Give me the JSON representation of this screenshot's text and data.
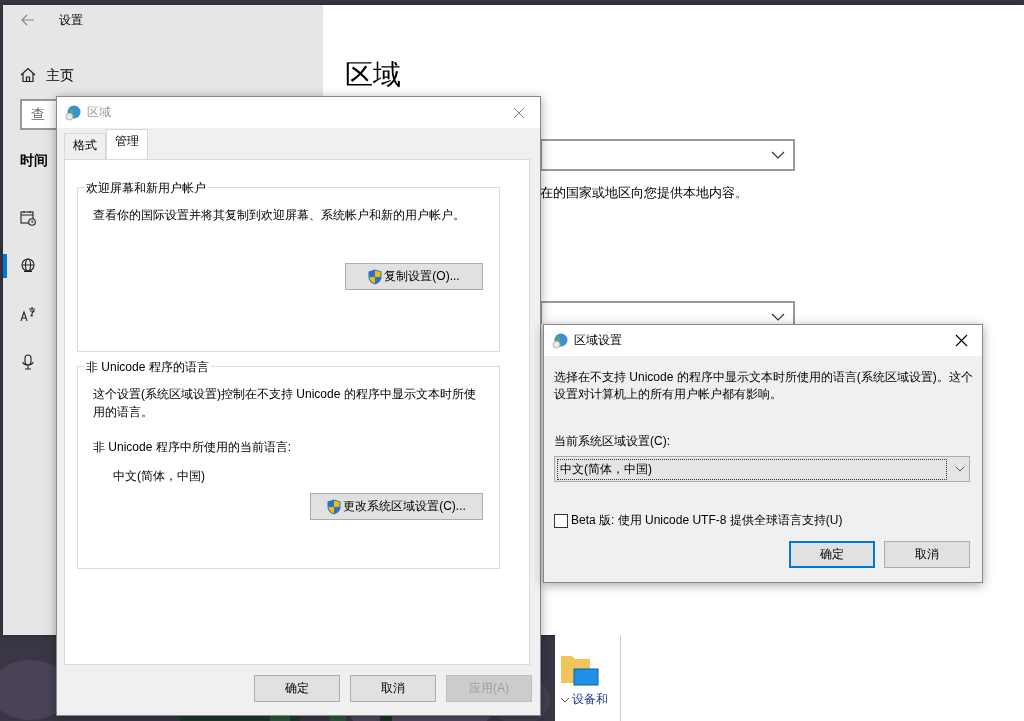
{
  "settings_window": {
    "title": "设置",
    "home": "主页",
    "search": {
      "placeholder": "查"
    },
    "section": "时间",
    "nav_items": [
      {
        "kind": "calendar",
        "selected": false
      },
      {
        "kind": "globe",
        "selected": true
      },
      {
        "kind": "language",
        "selected": false
      },
      {
        "kind": "microphone",
        "selected": false
      }
    ],
    "page_title": "区域",
    "region_text": "在的国家或地区向您提供本地内容。"
  },
  "region_dialog": {
    "title": "区域",
    "active": false,
    "tabs": [
      {
        "label": "格式",
        "selected": false
      },
      {
        "label": "管理",
        "selected": true
      }
    ],
    "groups": [
      {
        "legend": "欢迎屏幕和新用户帐户",
        "text": "查看你的国际设置并将其复制到欢迎屏幕、系统帐户和新的用户帐户。",
        "button": "复制设置(O)..."
      },
      {
        "legend": "非 Unicode 程序的语言",
        "text": "这个设置(系统区域设置)控制在不支持 Unicode 的程序中显示文本时所使用的语言。",
        "label": "非 Unicode 程序中所使用的当前语言:",
        "value": "中文(简体，中国)",
        "button": "更改系统区域设置(C)..."
      }
    ],
    "buttons": [
      {
        "label": "确定",
        "disabled": false
      },
      {
        "label": "取消",
        "disabled": false
      },
      {
        "label": "应用(A)",
        "disabled": true
      }
    ]
  },
  "region_settings_dialog": {
    "title": "区域设置",
    "description": "选择在不支持 Unicode 的程序中显示文本时所使用的语言(系统区域设置)。这个设置对计算机上的所有用户帐户都有影响。",
    "select_label": "当前系统区域设置(C):",
    "select_value": "中文(简体，中国)",
    "checkbox": {
      "label": "Beta 版: 使用 Unicode UTF-8 提供全球语言支持(U)",
      "checked": false
    },
    "buttons": [
      {
        "label": "确定",
        "default": true
      },
      {
        "label": "取消",
        "default": false
      }
    ]
  },
  "explorer": {
    "items": [
      {
        "label": "设备和"
      }
    ]
  }
}
